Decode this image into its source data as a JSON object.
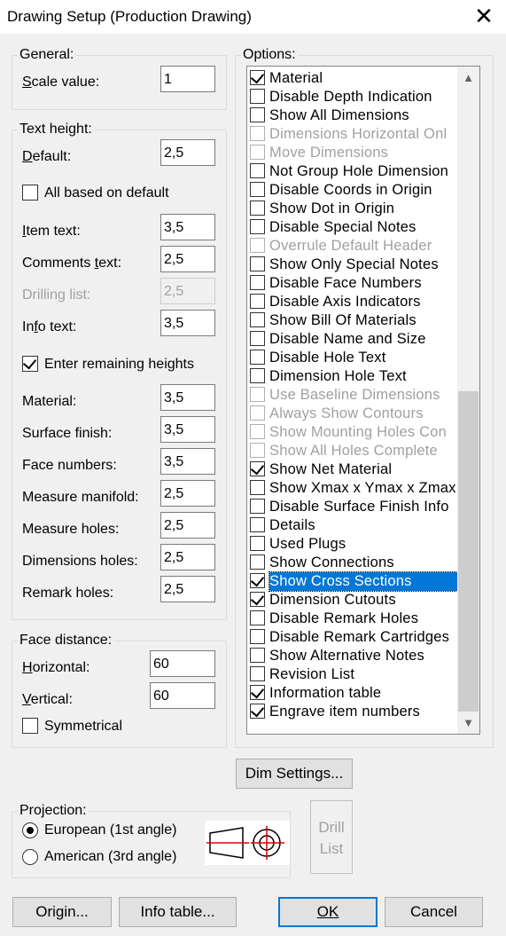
{
  "window": {
    "title": "Drawing Setup (Production Drawing)"
  },
  "general": {
    "group_label": "General:",
    "scale_label": "Scale value:",
    "scale_value": "1"
  },
  "text_height": {
    "group_label": "Text height:",
    "default_label": "Default:",
    "default_value": "2,5",
    "all_based_label": "All based on default",
    "item_text_label": "Item text:",
    "item_text_value": "3,5",
    "comments_label": "Comments text:",
    "comments_value": "2,5",
    "drilling_label": "Drilling list:",
    "drilling_value": "2,5",
    "info_label": "Info text:",
    "info_value": "3,5",
    "enter_remaining_label": "Enter remaining heights",
    "material_label": "Material:",
    "material_value": "3,5",
    "surface_label": "Surface finish:",
    "surface_value": "3,5",
    "face_numbers_label": "Face numbers:",
    "face_numbers_value": "3,5",
    "measure_manifold_label": "Measure manifold:",
    "measure_manifold_value": "2,5",
    "measure_holes_label": "Measure holes:",
    "measure_holes_value": "2,5",
    "dimensions_holes_label": "Dimensions holes:",
    "dimensions_holes_value": "2,5",
    "remark_holes_label": "Remark holes:",
    "remark_holes_value": "2,5"
  },
  "face_distance": {
    "group_label": "Face distance:",
    "horizontal_label": "Horizontal:",
    "horizontal_value": "60",
    "vertical_label": "Vertical:",
    "vertical_value": "60",
    "symmetrical_label": "Symmetrical"
  },
  "options": {
    "group_label": "Options:",
    "items": [
      {
        "label": "Material",
        "checked": true,
        "disabled": false
      },
      {
        "label": "Disable Depth Indication",
        "checked": false,
        "disabled": false
      },
      {
        "label": "Show All Dimensions",
        "checked": false,
        "disabled": false
      },
      {
        "label": "Dimensions Horizontal Onl",
        "checked": false,
        "disabled": true
      },
      {
        "label": "Move Dimensions",
        "checked": false,
        "disabled": true
      },
      {
        "label": "Not Group Hole Dimension",
        "checked": false,
        "disabled": false
      },
      {
        "label": "Disable Coords in Origin",
        "checked": false,
        "disabled": false
      },
      {
        "label": "Show Dot in Origin",
        "checked": false,
        "disabled": false
      },
      {
        "label": "Disable Special Notes",
        "checked": false,
        "disabled": false
      },
      {
        "label": "Overrule Default Header",
        "checked": false,
        "disabled": true
      },
      {
        "label": "Show Only Special Notes",
        "checked": false,
        "disabled": false
      },
      {
        "label": "Disable Face Numbers",
        "checked": false,
        "disabled": false
      },
      {
        "label": "Disable Axis Indicators",
        "checked": false,
        "disabled": false
      },
      {
        "label": "Show Bill Of Materials",
        "checked": false,
        "disabled": false
      },
      {
        "label": "Disable Name and Size",
        "checked": false,
        "disabled": false
      },
      {
        "label": "Disable Hole Text",
        "checked": false,
        "disabled": false
      },
      {
        "label": "Dimension Hole Text",
        "checked": false,
        "disabled": false
      },
      {
        "label": "Use Baseline Dimensions",
        "checked": false,
        "disabled": true
      },
      {
        "label": "Always Show Contours",
        "checked": false,
        "disabled": true
      },
      {
        "label": "Show Mounting Holes Con",
        "checked": false,
        "disabled": true
      },
      {
        "label": "Show All Holes Complete",
        "checked": false,
        "disabled": true
      },
      {
        "label": "Show Net Material",
        "checked": true,
        "disabled": false
      },
      {
        "label": "Show Xmax x Ymax x Zmax",
        "checked": false,
        "disabled": false
      },
      {
        "label": "Disable Surface Finish Info",
        "checked": false,
        "disabled": false
      },
      {
        "label": "Details",
        "checked": false,
        "disabled": false
      },
      {
        "label": "Used Plugs",
        "checked": false,
        "disabled": false
      },
      {
        "label": "Show Connections",
        "checked": false,
        "disabled": false
      },
      {
        "label": "Show Cross Sections",
        "checked": true,
        "disabled": false,
        "selected": true
      },
      {
        "label": "Dimension Cutouts",
        "checked": true,
        "disabled": false
      },
      {
        "label": "Disable Remark Holes",
        "checked": false,
        "disabled": false
      },
      {
        "label": "Disable Remark Cartridges",
        "checked": false,
        "disabled": false
      },
      {
        "label": "Show Alternative Notes",
        "checked": false,
        "disabled": false
      },
      {
        "label": "Revision List",
        "checked": false,
        "disabled": false
      },
      {
        "label": "Information table",
        "checked": true,
        "disabled": false
      },
      {
        "label": "Engrave item numbers",
        "checked": true,
        "disabled": false
      }
    ]
  },
  "dim_settings_label": "Dim Settings...",
  "projection": {
    "group_label": "Projection:",
    "european_label": "European (1st angle)",
    "american_label": "American (3rd angle)",
    "selected": "european"
  },
  "drill_list_label_1": "Drill",
  "drill_list_label_2": "List",
  "buttons": {
    "origin": "Origin...",
    "info_table": "Info table...",
    "ok": "OK",
    "cancel": "Cancel"
  },
  "colors": {
    "selection": "#0078d7",
    "window_bg": "#f0f0f0",
    "symbol_red": "#e00000"
  }
}
